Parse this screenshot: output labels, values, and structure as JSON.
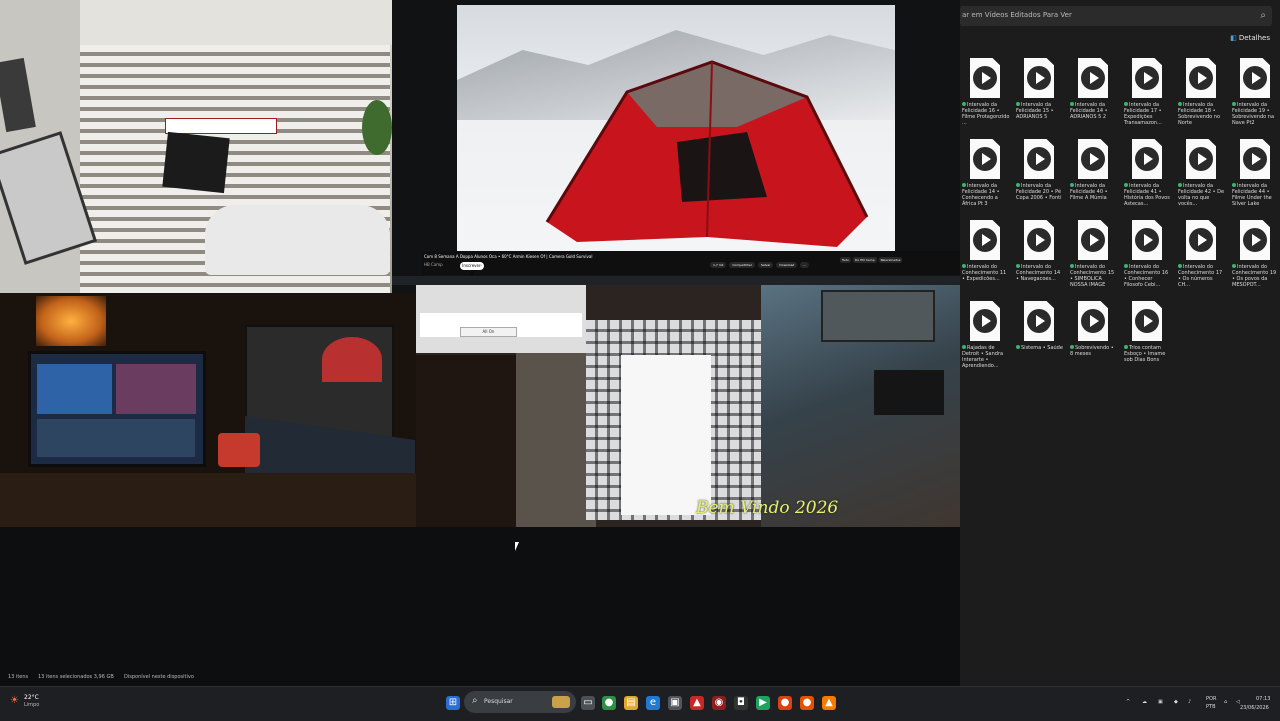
{
  "video": {
    "title": "Com 8 Semana A Doppa Alunos Oca • 60°C Armin Kiesen Of | Camera Gold Survival",
    "channel": "HB Camp",
    "subscribe": "Inscrever-se",
    "actions": [
      "1,7 mil",
      "Compartilhar",
      "Salvar",
      "Download",
      "..."
    ],
    "chips": [
      "Tudo",
      "Do Hill Camp",
      "Relacionados"
    ]
  },
  "dialog": {
    "button": "All On"
  },
  "overlay_text": "Bem Vindo 2026",
  "explorer": {
    "search_placeholder": "ar em Vídeos Editados Para Ver",
    "details_label": "Detalhes",
    "files": [
      "Intervalo da Felicidade 16 • Filme Protagonzido ...",
      "Intervalo da Felicidade 15 • ADRIANOS 5",
      "Intervalo da Felicidade 14 • ADRIANOS 5 2",
      "Intervalo da Felicidade 17 • Expedições Transamazon...",
      "Intervalo da Felicidade 18 • Sobrevivendo no Norte",
      "Intervalo da Felicidade 19 • Sobrevivendo na Nave Pt2",
      "Intervalo da Felicidade 14 • Conhecendo a África Pt 3",
      "Intervalo da Felicidade 20 • Pé Copa 2006 • Fonti",
      "Intervalo da Felicidade 40 • Filme A Múmia",
      "Intervalo da Felicidade 41 • História dos Povos Astecas...",
      "Intervalo da Felicidade 42 • De volta no que vocês...",
      "Intervalo da Felicidade 44 • Filme Under the Silver Lake",
      "Intervalo do Conhecimento 11 • Expedicões...",
      "Intervalo do Conhecimento 14 • Navegacoes...",
      "Intervalo do Conhecimento 15 • SIMBOLICA NOSSA IMAGE",
      "Intervalo do Conhecimento 16 • Conhecer Filosofo Cebi...",
      "Intervalo do Conhecimento 17 • Os números CH...",
      "Intervalo do Conhecimento 19 • Os povos da MESOPOT...",
      "Rajadas de Detroit • Sandra Interarte • Aprendiendo...",
      "Sistema • Saúde",
      "Sobrevivendo • 8 meses",
      "Trios contam Esboço • Imame sob Dias Bons"
    ]
  },
  "status": {
    "items": "13 itens",
    "selected": "13 itens selecionados 3,96 GB",
    "available": "Disponível neste dispositivo"
  },
  "taskbar": {
    "temp": "22°C",
    "condition": "Limpo",
    "search": "Pesquisar",
    "lang": "POR",
    "lang2": "PTB",
    "time": "07:13",
    "date": "23/06/2026"
  }
}
